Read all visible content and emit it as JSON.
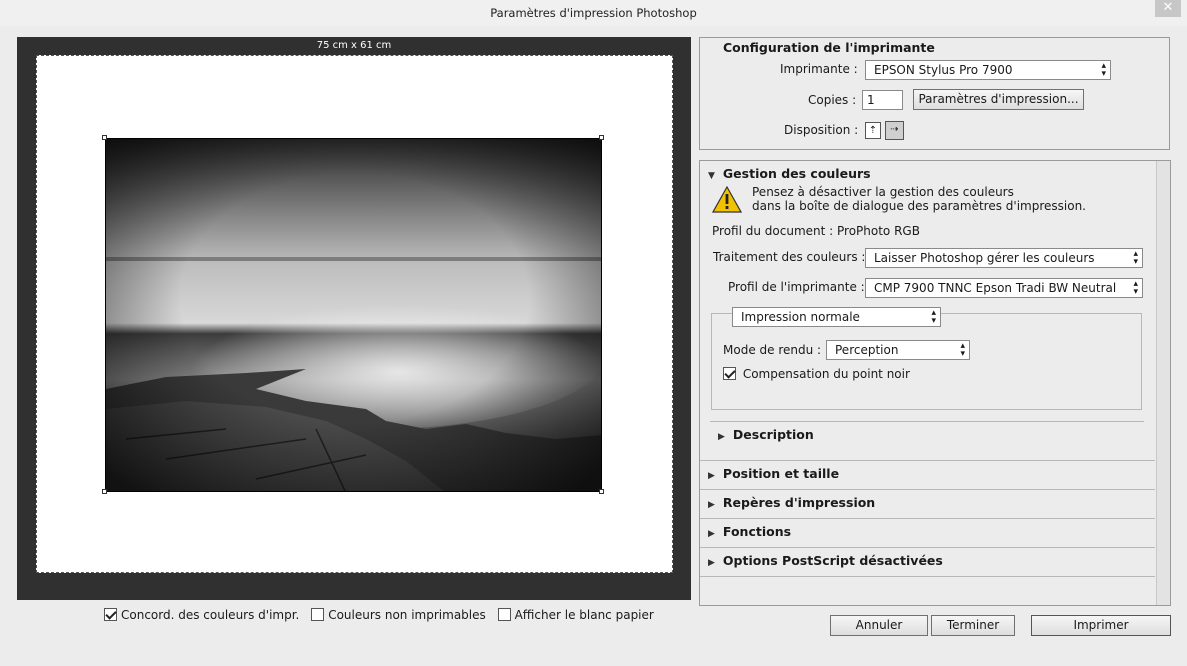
{
  "window": {
    "title": "Paramètres d'impression Photoshop",
    "close": "✕"
  },
  "preview": {
    "size_label": "75 cm x 61 cm"
  },
  "bottom_options": [
    {
      "label": "Concord. des couleurs d'impr.",
      "checked": true
    },
    {
      "label": "Couleurs non imprimables",
      "checked": false
    },
    {
      "label": "Afficher le blanc papier",
      "checked": false
    }
  ],
  "printer_config": {
    "heading": "Configuration de l'imprimante",
    "printer_label": "Imprimante :",
    "printer_value": "EPSON Stylus Pro 7900",
    "copies_label": "Copies :",
    "copies_value": "1",
    "print_settings_button": "Paramètres d'impression...",
    "layout_label": "Disposition :"
  },
  "color_management": {
    "heading": "Gestion des couleurs",
    "warning_line1": "Pensez à désactiver la gestion des couleurs",
    "warning_line2": "dans la boîte de dialogue des paramètres d'impression.",
    "document_profile": "Profil du document : ProPhoto RGB",
    "color_handling_label": "Traitement des couleurs :",
    "color_handling_value": "Laisser Photoshop gérer les couleurs",
    "printer_profile_label": "Profil de l'imprimante :",
    "printer_profile_value": "CMP 7900 TNNC Epson Tradi BW Neutral",
    "print_mode_value": "Impression normale",
    "rendering_intent_label": "Mode de rendu :",
    "rendering_intent_value": "Perception",
    "black_point_label": "Compensation du point noir",
    "black_point_checked": true,
    "description_label": "Description"
  },
  "sections": [
    "Position et taille",
    "Repères d'impression",
    "Fonctions",
    "Options PostScript désactivées"
  ],
  "buttons": {
    "cancel": "Annuler",
    "done": "Terminer",
    "print": "Imprimer"
  }
}
